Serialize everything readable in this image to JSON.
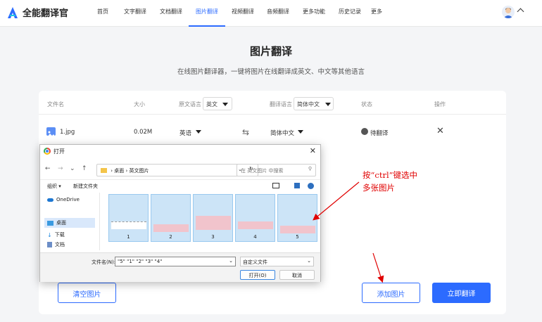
{
  "app": {
    "logo_text": "全能翻译官"
  },
  "nav": [
    "首页",
    "文字翻译",
    "文档翻译",
    "图片翻译",
    "视频翻译",
    "音频翻译",
    "更多功能",
    "历史记录",
    "更多"
  ],
  "nav_active_index": 3,
  "page": {
    "title": "图片翻译",
    "subtitle": "在线图片翻译器，一键将图片在线翻译成英文、中文等其他语言"
  },
  "table": {
    "headers": {
      "file": "文件名",
      "size": "大小",
      "src_lang": "原文语言",
      "tgt_lang": "翻译语言",
      "status": "状态",
      "action": "操作"
    },
    "header_src_value": "英文",
    "header_tgt_value": "简体中文",
    "row": {
      "file": "1.jpg",
      "size": "0.02M",
      "src": "英语",
      "tgt": "简体中文",
      "status": "待翻译"
    }
  },
  "buttons": {
    "clear": "清空图片",
    "add": "添加图片",
    "translate": "立即翻译"
  },
  "dialog": {
    "title": "打开",
    "path": [
      "桌面",
      "英文图片"
    ],
    "search_placeholder": "在 英文图片 中搜索",
    "organize": "组织 ▾",
    "new_folder": "新建文件夹",
    "sidebar": [
      "OneDrive",
      "桌面",
      "下载",
      "文档"
    ],
    "thumbs": [
      "1",
      "2",
      "3",
      "4",
      "5"
    ],
    "filename_label": "文件名(N):",
    "filename_value": "\"5\" \"1\" \"2\" \"3\" \"4\"",
    "filetype": "自定义文件",
    "open": "打开(O)",
    "cancel": "取消"
  },
  "annotation": {
    "line1": "按“ctrl”键选中",
    "line2": "多张图片",
    "color": "#e00000"
  },
  "colors": {
    "accent": "#2c6bff"
  }
}
